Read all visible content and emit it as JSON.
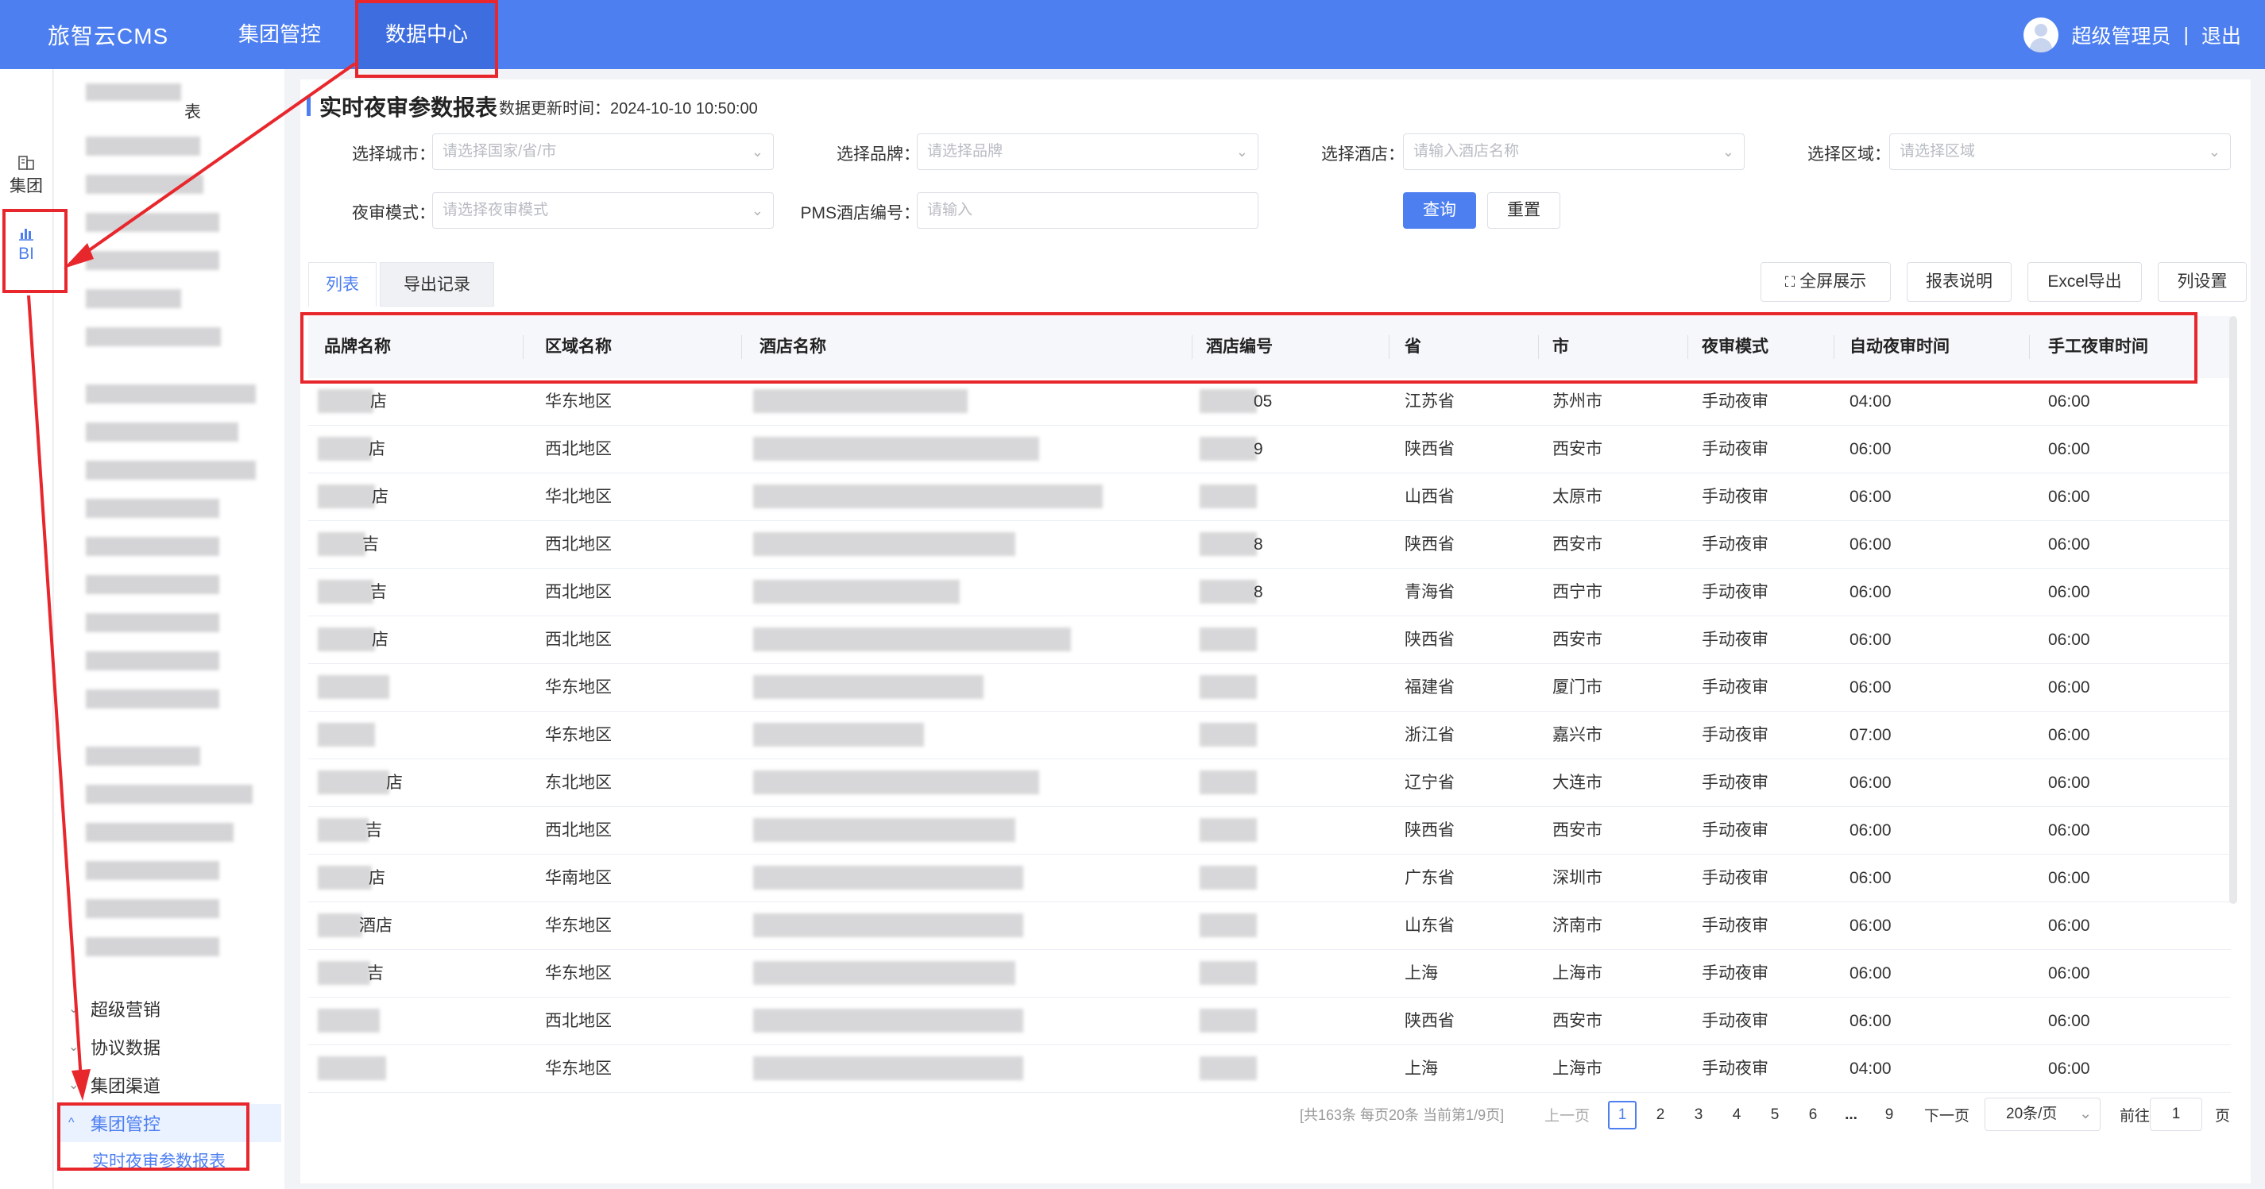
{
  "app": {
    "brand": "旅智云CMS"
  },
  "nav": {
    "items": [
      "集团管控",
      "数据中心"
    ]
  },
  "user": {
    "name": "超级管理员",
    "divider": "|",
    "logout": "退出"
  },
  "iconbar": {
    "items": [
      {
        "label": "集团",
        "icon": "building-icon"
      },
      {
        "label": "BI",
        "icon": "bar-chart-icon"
      }
    ]
  },
  "sidemenu": {
    "partial_top": "表",
    "groups": [
      "超级营销",
      "协议数据",
      "集团渠道"
    ],
    "active_group": "集团管控",
    "active_item": "实时夜审参数报表"
  },
  "page": {
    "title": "实时夜审参数报表",
    "updated": "数据更新时间：2024-10-10 10:50:00"
  },
  "filters": {
    "city": {
      "label": "选择城市：",
      "placeholder": "请选择国家/省/市"
    },
    "brand": {
      "label": "选择品牌：",
      "placeholder": "请选择品牌"
    },
    "hotel": {
      "label": "选择酒店：",
      "placeholder": "请输入酒店名称"
    },
    "region": {
      "label": "选择区域：",
      "placeholder": "请选择区域"
    },
    "mode": {
      "label": "夜审模式：",
      "placeholder": "请选择夜审模式"
    },
    "pms": {
      "label": "PMS酒店编号：",
      "placeholder": "请输入"
    },
    "query": "查询",
    "reset": "重置"
  },
  "tabs": [
    "列表",
    "导出记录"
  ],
  "toolbar": {
    "fullscreen": "全屏展示",
    "explain": "报表说明",
    "export": "Excel导出",
    "columns": "列设置"
  },
  "table": {
    "headers": [
      "品牌名称",
      "区域名称",
      "酒店名称",
      "酒店编号",
      "省",
      "市",
      "夜审模式",
      "自动夜审时间",
      "手工夜审时间"
    ],
    "rows": [
      {
        "brand": "店",
        "region": "华东地区",
        "code": "05",
        "province": "江苏省",
        "city": "苏州市",
        "mode": "手动夜审",
        "auto": "04:00",
        "manual": "06:00"
      },
      {
        "brand": "店",
        "region": "西北地区",
        "code": "9",
        "province": "陕西省",
        "city": "西安市",
        "mode": "手动夜审",
        "auto": "06:00",
        "manual": "06:00"
      },
      {
        "brand": "店",
        "region": "华北地区",
        "code": "",
        "province": "山西省",
        "city": "太原市",
        "mode": "手动夜审",
        "auto": "06:00",
        "manual": "06:00"
      },
      {
        "brand": "吉",
        "region": "西北地区",
        "code": "8",
        "province": "陕西省",
        "city": "西安市",
        "mode": "手动夜审",
        "auto": "06:00",
        "manual": "06:00"
      },
      {
        "brand": "吉",
        "region": "西北地区",
        "code": "8",
        "province": "青海省",
        "city": "西宁市",
        "mode": "手动夜审",
        "auto": "06:00",
        "manual": "06:00"
      },
      {
        "brand": "店",
        "region": "西北地区",
        "code": "",
        "province": "陕西省",
        "city": "西安市",
        "mode": "手动夜审",
        "auto": "06:00",
        "manual": "06:00"
      },
      {
        "brand": "",
        "region": "华东地区",
        "code": "",
        "province": "福建省",
        "city": "厦门市",
        "mode": "手动夜审",
        "auto": "06:00",
        "manual": "06:00"
      },
      {
        "brand": "",
        "region": "华东地区",
        "code": "",
        "province": "浙江省",
        "city": "嘉兴市",
        "mode": "手动夜审",
        "auto": "07:00",
        "manual": "06:00"
      },
      {
        "brand": "店",
        "region": "东北地区",
        "code": "",
        "province": "辽宁省",
        "city": "大连市",
        "mode": "手动夜审",
        "auto": "06:00",
        "manual": "06:00"
      },
      {
        "brand": "吉",
        "region": "西北地区",
        "code": "",
        "province": "陕西省",
        "city": "西安市",
        "mode": "手动夜审",
        "auto": "06:00",
        "manual": "06:00"
      },
      {
        "brand": "店",
        "region": "华南地区",
        "code": "",
        "province": "广东省",
        "city": "深圳市",
        "mode": "手动夜审",
        "auto": "06:00",
        "manual": "06:00"
      },
      {
        "brand": "酒店",
        "region": "华东地区",
        "code": "",
        "province": "山东省",
        "city": "济南市",
        "mode": "手动夜审",
        "auto": "06:00",
        "manual": "06:00"
      },
      {
        "brand": "吉",
        "region": "华东地区",
        "code": "",
        "province": "上海",
        "city": "上海市",
        "mode": "手动夜审",
        "auto": "06:00",
        "manual": "06:00"
      },
      {
        "brand": "",
        "region": "西北地区",
        "code": "",
        "province": "陕西省",
        "city": "西安市",
        "mode": "手动夜审",
        "auto": "06:00",
        "manual": "06:00"
      },
      {
        "brand": "",
        "region": "华东地区",
        "code": "",
        "province": "上海",
        "city": "上海市",
        "mode": "手动夜审",
        "auto": "04:00",
        "manual": "06:00"
      }
    ]
  },
  "pagination": {
    "summary": "[共163条 每页20条 当前第1/9页]",
    "prev": "上一页",
    "pages": [
      "1",
      "2",
      "3",
      "4",
      "5",
      "6",
      "...",
      "9"
    ],
    "current": "1",
    "next": "下一页",
    "page_size": "20条/页",
    "goto": "前往",
    "goto_value": "1",
    "page_unit": "页"
  },
  "colors": {
    "primary": "#4d7ff0",
    "annotation": "#e8272d"
  }
}
